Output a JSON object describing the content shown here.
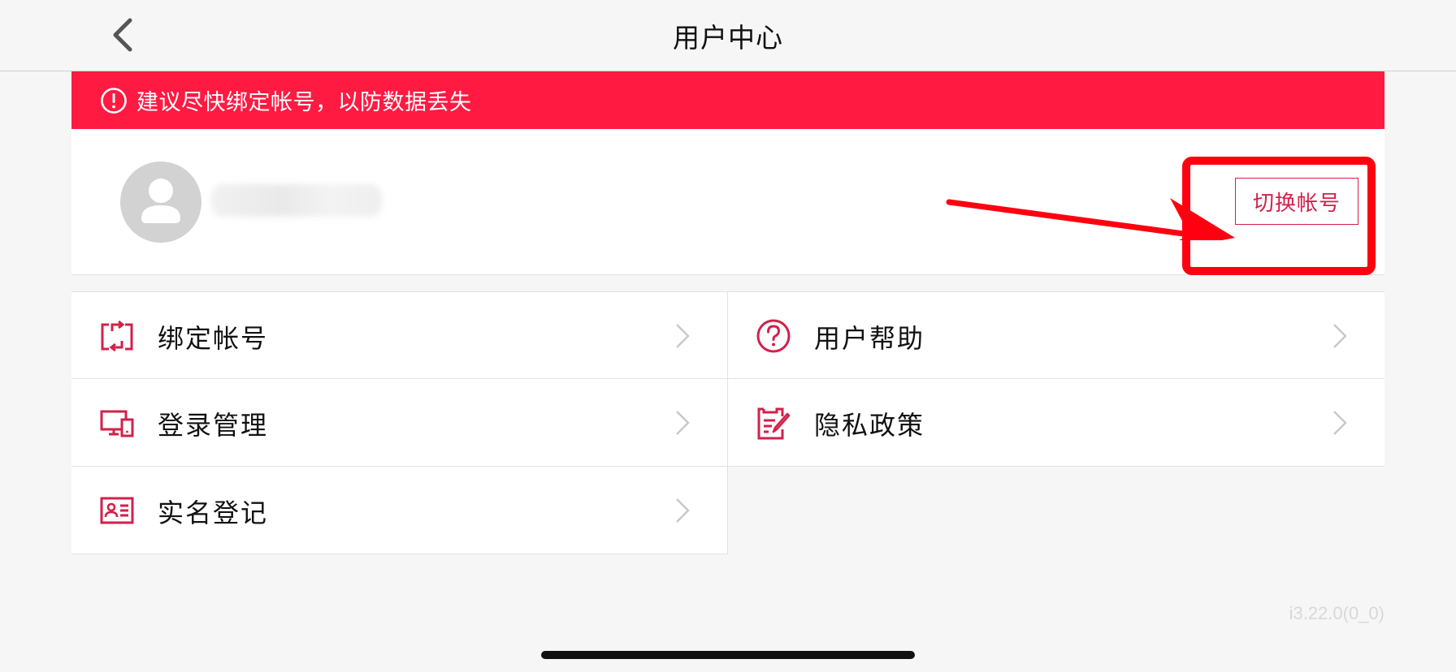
{
  "header": {
    "title": "用户中心"
  },
  "banner": {
    "text": "建议尽快绑定帐号，以防数据丢失"
  },
  "profile": {
    "switch_label": "切换帐号"
  },
  "menu": {
    "bind_account": "绑定帐号",
    "user_help": "用户帮助",
    "login_management": "登录管理",
    "privacy_policy": "隐私政策",
    "real_name_registration": "实名登记"
  },
  "footer": {
    "version": "i3.22.0(0_0)"
  },
  "colors": {
    "accent": "#ff1a42",
    "icon_red": "#d3204b",
    "annotation_red": "#ff0010"
  }
}
